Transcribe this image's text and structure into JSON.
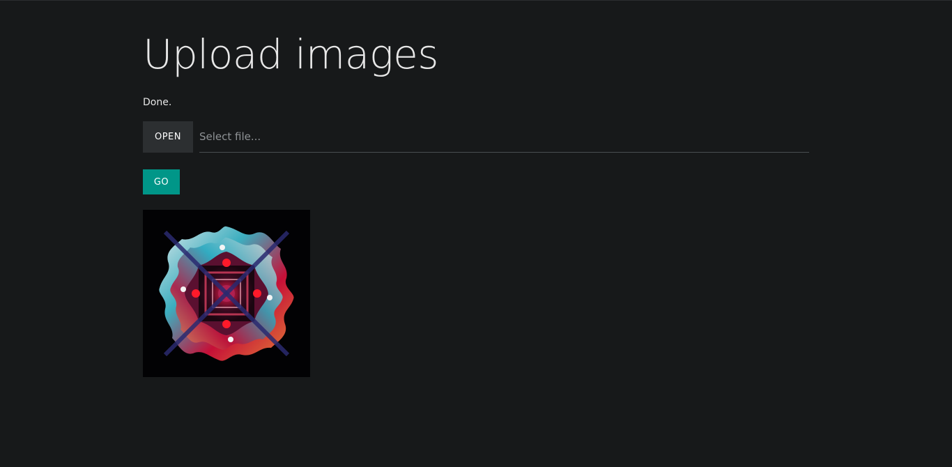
{
  "page": {
    "title": "Upload images",
    "status": "Done."
  },
  "file_picker": {
    "open_label": "OPEN",
    "placeholder": "Select file...",
    "value": ""
  },
  "actions": {
    "go_label": "GO"
  },
  "colors": {
    "background": "#17191a",
    "open_button": "#2c2f31",
    "go_button": "#009688"
  }
}
